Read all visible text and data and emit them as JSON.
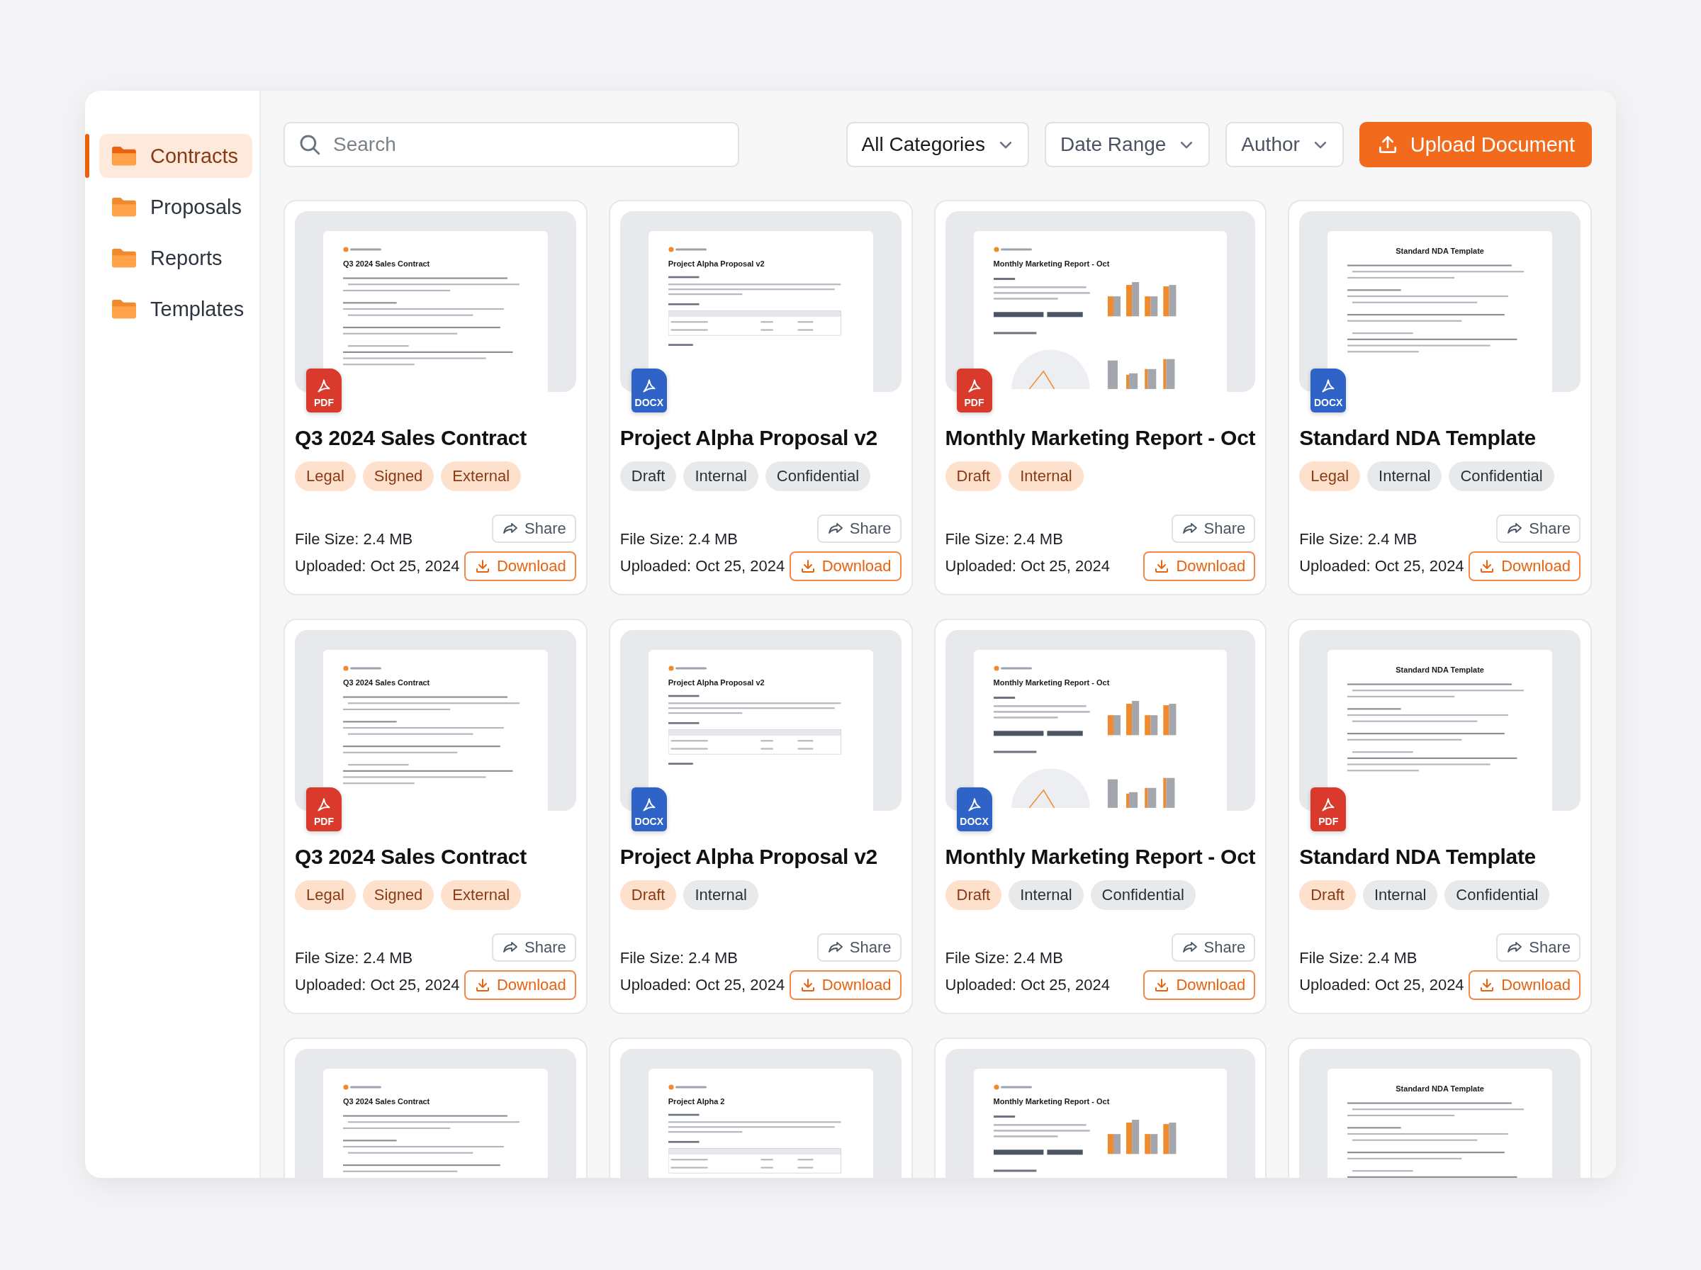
{
  "sidebar": {
    "items": [
      {
        "label": "Contracts",
        "selected": true
      },
      {
        "label": "Proposals",
        "selected": false
      },
      {
        "label": "Reports",
        "selected": false
      },
      {
        "label": "Templates",
        "selected": false
      }
    ]
  },
  "toolbar": {
    "search": {
      "placeholder": "Search"
    },
    "filters": [
      {
        "label": "All Categories",
        "active": true
      },
      {
        "label": "Date Range",
        "active": false
      },
      {
        "label": "Author",
        "active": false
      }
    ],
    "upload_button": "Upload Document"
  },
  "cards": [
    {
      "preview": {
        "kind": "contract",
        "title": "Q3 2024 Sales Contract"
      },
      "file": {
        "kind": "pdf",
        "label": "PDF"
      },
      "title": "Q3 2024 Sales Contract",
      "tags": [
        {
          "label": "Legal",
          "color": "#fde1cc"
        },
        {
          "label": "Signed",
          "color": "#fde1cc"
        },
        {
          "label": "External",
          "color": "#fde1cc"
        }
      ],
      "file_size": "File Size: 2.4 MB",
      "uploaded": "Uploaded: Oct 25, 2024",
      "share": "Share",
      "download": "Download"
    },
    {
      "preview": {
        "kind": "proposal",
        "title": "Project Alpha Proposal v2"
      },
      "file": {
        "kind": "docx",
        "label": "DOCX"
      },
      "title": "Project Alpha Proposal v2",
      "tags": [
        {
          "label": "Draft",
          "color": "#e8e9eb"
        },
        {
          "label": "Internal",
          "color": "#e8e9eb"
        },
        {
          "label": "Confidential",
          "color": "#e8e9eb"
        }
      ],
      "file_size": "File Size: 2.4 MB",
      "uploaded": "Uploaded: Oct 25, 2024",
      "share": "Share",
      "download": "Download"
    },
    {
      "preview": {
        "kind": "report",
        "title": "Monthly Marketing Report - Oct"
      },
      "file": {
        "kind": "pdf",
        "label": "PDF"
      },
      "title": "Monthly Marketing Report - Oct",
      "tags": [
        {
          "label": "Draft",
          "color": "#fde1cc"
        },
        {
          "label": "Internal",
          "color": "#fde1cc"
        }
      ],
      "file_size": "File Size: 2.4 MB",
      "uploaded": "Uploaded: Oct 25, 2024",
      "share": "Share",
      "download": "Download"
    },
    {
      "preview": {
        "kind": "nda",
        "title": "Standard NDA Template"
      },
      "file": {
        "kind": "docx",
        "label": "DOCX"
      },
      "title": "Standard NDA Template",
      "tags": [
        {
          "label": "Legal",
          "color": "#fde1cc"
        },
        {
          "label": "Internal",
          "color": "#e8e9eb"
        },
        {
          "label": "Confidential",
          "color": "#e8e9eb"
        }
      ],
      "file_size": "File Size: 2.4 MB",
      "uploaded": "Uploaded: Oct 25, 2024",
      "share": "Share",
      "download": "Download"
    },
    {
      "preview": {
        "kind": "contract",
        "title": "Q3 2024 Sales Contract"
      },
      "file": {
        "kind": "pdf",
        "label": "PDF"
      },
      "title": "Q3 2024 Sales Contract",
      "tags": [
        {
          "label": "Legal",
          "color": "#fde1cc"
        },
        {
          "label": "Signed",
          "color": "#fde1cc"
        },
        {
          "label": "External",
          "color": "#fde1cc"
        }
      ],
      "file_size": "File Size: 2.4 MB",
      "uploaded": "Uploaded: Oct 25, 2024",
      "share": "Share",
      "download": "Download"
    },
    {
      "preview": {
        "kind": "proposal",
        "title": "Project Alpha Proposal v2"
      },
      "file": {
        "kind": "docx",
        "label": "DOCX"
      },
      "title": "Project Alpha Proposal v2",
      "tags": [
        {
          "label": "Draft",
          "color": "#fde1cc"
        },
        {
          "label": "Internal",
          "color": "#e8e9eb"
        }
      ],
      "file_size": "File Size: 2.4 MB",
      "uploaded": "Uploaded: Oct 25, 2024",
      "share": "Share",
      "download": "Download"
    },
    {
      "preview": {
        "kind": "report",
        "title": "Monthly Marketing Report - Oct"
      },
      "file": {
        "kind": "docx",
        "label": "DOCX"
      },
      "title": "Monthly Marketing Report - Oct",
      "tags": [
        {
          "label": "Draft",
          "color": "#fde1cc"
        },
        {
          "label": "Internal",
          "color": "#e8e9eb"
        },
        {
          "label": "Confidential",
          "color": "#e8e9eb"
        }
      ],
      "file_size": "File Size: 2.4 MB",
      "uploaded": "Uploaded: Oct 25, 2024",
      "share": "Share",
      "download": "Download"
    },
    {
      "preview": {
        "kind": "nda",
        "title": "Standard NDA Template"
      },
      "file": {
        "kind": "pdf",
        "label": "PDF"
      },
      "title": "Standard NDA Template",
      "tags": [
        {
          "label": "Draft",
          "color": "#fde1cc"
        },
        {
          "label": "Internal",
          "color": "#e8e9eb"
        },
        {
          "label": "Confidential",
          "color": "#e8e9eb"
        }
      ],
      "file_size": "File Size: 2.4 MB",
      "uploaded": "Uploaded: Oct 25, 2024",
      "share": "Share",
      "download": "Download"
    },
    {
      "preview": {
        "kind": "contract",
        "title": "Q3 2024 Sales Contract"
      }
    },
    {
      "preview": {
        "kind": "proposal",
        "title": "Project Alpha 2"
      }
    },
    {
      "preview": {
        "kind": "report",
        "title": "Monthly Marketing Report - Oct"
      }
    },
    {
      "preview": {
        "kind": "nda",
        "title": "Standard NDA Template"
      }
    }
  ]
}
